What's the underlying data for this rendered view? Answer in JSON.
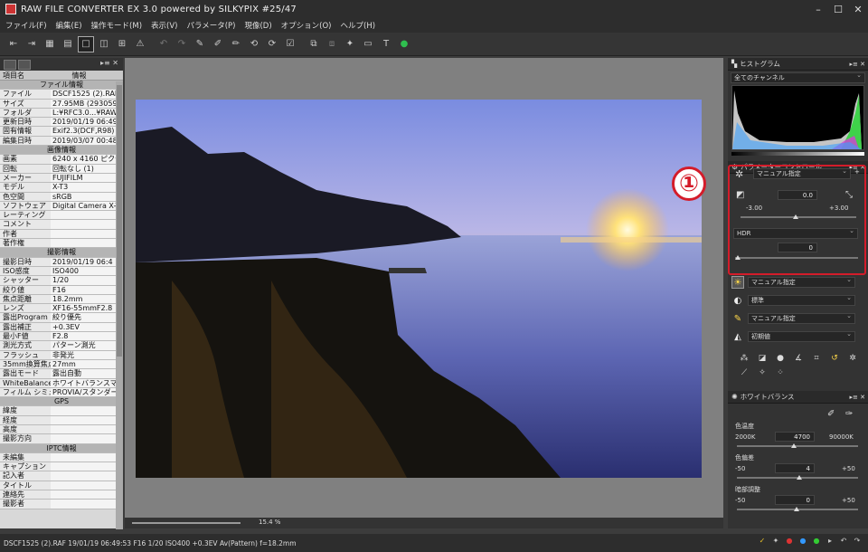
{
  "window": {
    "title": "RAW FILE CONVERTER EX 3.0 powered by SILKYPIX   #25/47"
  },
  "menu": [
    "ファイル(F)",
    "編集(E)",
    "操作モード(M)",
    "表示(V)",
    "パラメータ(P)",
    "現像(D)",
    "オプション(O)",
    "ヘルプ(H)"
  ],
  "toolbar_icons": [
    "prev-icon",
    "next-icon",
    "grid-icon",
    "grid2-icon",
    "single-view-icon",
    "compare-icon",
    "quad-icon",
    "warning-icon",
    "undo-icon",
    "redo-icon",
    "paste-icon",
    "copy-icon",
    "edit-icon",
    "rotate-left-icon",
    "rotate-right-icon",
    "develop-icon",
    "batch-icon",
    "layers-icon",
    "brush-icon",
    "display-icon",
    "text-icon",
    "ok-icon"
  ],
  "info": {
    "header": {
      "name": "項目名",
      "value": "情報"
    },
    "rows": [
      {
        "sec": "ファイル情報"
      },
      {
        "k": "ファイル",
        "v": "DSCF1525 (2).RAF"
      },
      {
        "k": "サイズ",
        "v": "27.95MB (2930592"
      },
      {
        "k": "フォルダ",
        "v": "L:¥RFC3.0...¥RAW"
      },
      {
        "k": "更新日時",
        "v": "2019/01/19 06:49"
      },
      {
        "k": "固有情報",
        "v": "Exif2.3(DCF,R98) Y"
      },
      {
        "k": "編集日時",
        "v": "2019/03/07 00:48"
      },
      {
        "sec": "画像情報"
      },
      {
        "k": "画素",
        "v": "6240 x 4160 ピクセ"
      },
      {
        "k": "回転",
        "v": "回転なし (1)"
      },
      {
        "k": "メーカー",
        "v": "FUJIFILM"
      },
      {
        "k": "モデル",
        "v": "X-T3"
      },
      {
        "k": "色空間",
        "v": "sRGB"
      },
      {
        "k": "ソフトウェア",
        "v": "Digital Camera X-T"
      },
      {
        "k": "レーティング",
        "v": ""
      },
      {
        "k": "コメント",
        "v": ""
      },
      {
        "k": "作者",
        "v": ""
      },
      {
        "k": "著作権",
        "v": ""
      },
      {
        "sec": "撮影情報"
      },
      {
        "k": "撮影日時",
        "v": "2019/01/19 06:4"
      },
      {
        "k": "ISO感度",
        "v": "ISO400"
      },
      {
        "k": "シャッター",
        "v": "1/20"
      },
      {
        "k": "絞り値",
        "v": "F16"
      },
      {
        "k": "焦点距離",
        "v": "18.2mm"
      },
      {
        "k": "レンズ",
        "v": "XF16-55mmF2.8"
      },
      {
        "k": "露出Program",
        "v": "絞り優先"
      },
      {
        "k": "露出補正",
        "v": "+0.3EV"
      },
      {
        "k": "最小F値",
        "v": "F2.8"
      },
      {
        "k": "測光方式",
        "v": "パターン測光"
      },
      {
        "k": "フラッシュ",
        "v": "非発光"
      },
      {
        "k": "35mm換算焦点",
        "v": "27mm"
      },
      {
        "k": "露出モード",
        "v": "露出自動"
      },
      {
        "k": "WhiteBalance",
        "v": "ホワイトバランスマニュア"
      },
      {
        "k": "フィルム シミュレ",
        "v": "PROVIA/スタンダード"
      },
      {
        "sec": "GPS"
      },
      {
        "k": "緯度",
        "v": ""
      },
      {
        "k": "経度",
        "v": ""
      },
      {
        "k": "高度",
        "v": ""
      },
      {
        "k": "撮影方向",
        "v": ""
      },
      {
        "sec": "IPTC情報"
      },
      {
        "k": "未編集",
        "v": ""
      },
      {
        "k": "キャプション",
        "v": ""
      },
      {
        "k": "記入者",
        "v": ""
      },
      {
        "k": "タイトル",
        "v": ""
      },
      {
        "k": "連絡先",
        "v": ""
      },
      {
        "k": "撮影者",
        "v": ""
      }
    ]
  },
  "center": {
    "zoom": "15.4 %"
  },
  "histogram": {
    "title": "ヒストグラム",
    "channel": "全てのチャンネル"
  },
  "params": {
    "title": "パラメーターコントロール",
    "exposure_mode": "マニュアル指定",
    "exposure_value": "0.0",
    "exposure_min": "-3.00",
    "exposure_max": "+3.00",
    "hdr_label": "HDR",
    "hdr_value": "0",
    "row1": "マニュアル指定",
    "row2": "標準",
    "row3": "マニュアル指定",
    "row4": "初期値",
    "annotation": "①"
  },
  "wb": {
    "title": "ホワイトバランス",
    "temp_label": "色温度",
    "temp_min": "2000K",
    "temp_value": "4700",
    "temp_max": "90000K",
    "tint_label": "色偏差",
    "tint_min": "-50",
    "tint_value": "4",
    "tint_max": "+50",
    "shade_label": "暗部調整",
    "shade_min": "-50",
    "shade_value": "0",
    "shade_max": "+50"
  },
  "status": {
    "text": "DSCF1525 (2).RAF 19/01/19 06:49:53 F16 1/20 ISO400 +0.3EV Av(Pattern) f=18.2mm"
  }
}
